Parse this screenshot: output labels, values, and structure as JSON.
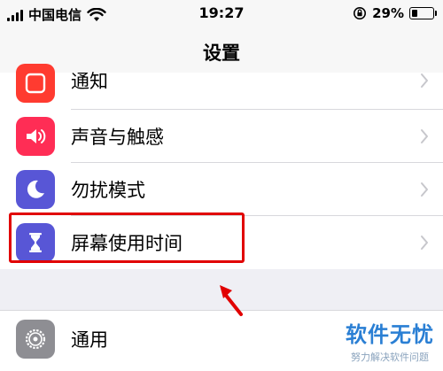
{
  "status_bar": {
    "carrier": "中国电信",
    "time": "19:27",
    "battery": {
      "percent_label": "29%",
      "level": 0.29
    }
  },
  "nav": {
    "title": "设置"
  },
  "settings_rows": [
    {
      "label": "通知",
      "icon": "notification-icon",
      "color": "#ff3b30"
    },
    {
      "label": "声音与触感",
      "icon": "sound-icon",
      "color": "#ff2d55"
    },
    {
      "label": "勿扰模式",
      "icon": "moon-icon",
      "color": "#5856d6"
    },
    {
      "label": "屏幕使用时间",
      "icon": "hourglass-icon",
      "color": "#5856d6"
    },
    {
      "label": "通用",
      "icon": "gear-icon",
      "color": "#8e8e93"
    }
  ],
  "watermark": {
    "title": "软件无忧",
    "subtitle": "努力解决软件问题"
  }
}
